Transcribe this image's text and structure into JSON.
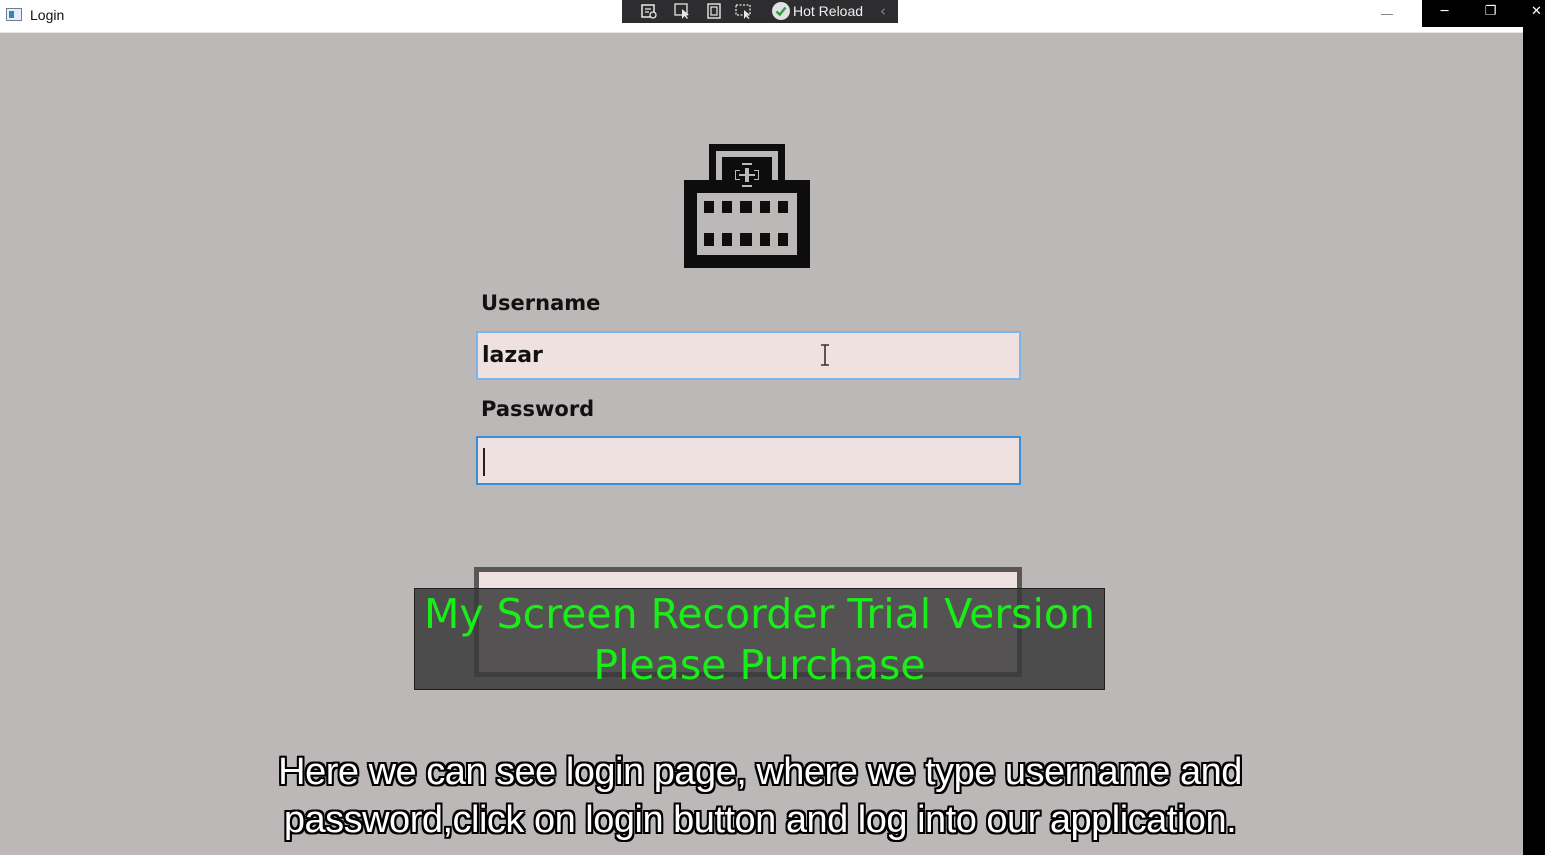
{
  "window": {
    "title": "Login"
  },
  "devtools": {
    "hot_reload_label": "Hot Reload",
    "tools": [
      "live-visual-tree-icon",
      "select-element-icon",
      "display-layout-adorners-icon",
      "track-focus-icon"
    ]
  },
  "caption_buttons": {
    "minimize": "─",
    "restore": "❐",
    "close": "✕"
  },
  "form": {
    "username_label": "Username",
    "username_value": "lazar",
    "password_label": "Password",
    "password_value": ""
  },
  "watermark": {
    "line1": "My Screen Recorder Trial Version",
    "line2": "Please Purchase"
  },
  "subtitles": {
    "line1": "Here we can see login page, where we type username and",
    "line2": "password,click on login button and log into our application."
  },
  "icons": {
    "logo": "hospital-icon",
    "mouse_cursor": "text-cursor-icon"
  },
  "colors": {
    "background": "#bcb8b7",
    "field_fill": "#efe1e0",
    "field_border": "#7eb4ea",
    "watermark_text": "#19ee19"
  }
}
